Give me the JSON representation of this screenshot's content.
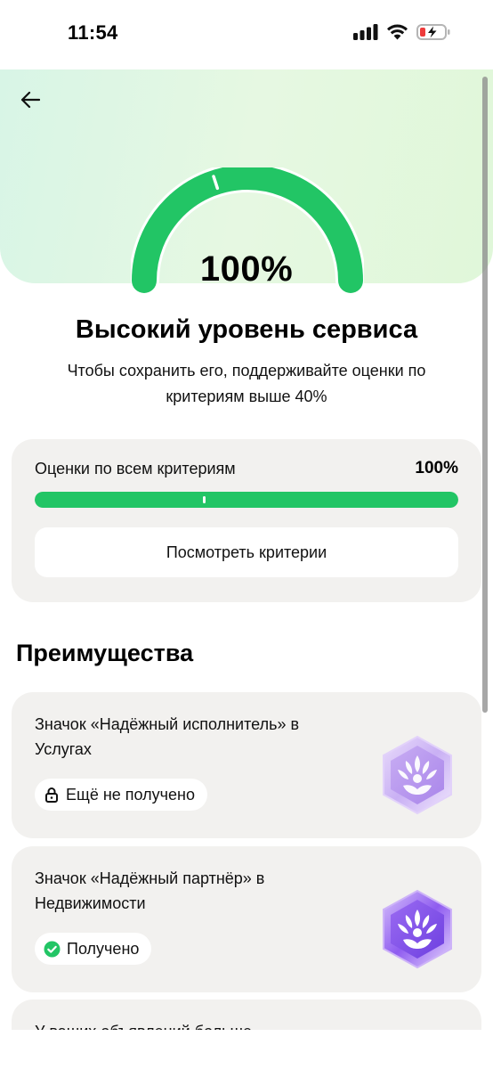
{
  "status_bar": {
    "time": "11:54",
    "icons": [
      "signal-icon",
      "wifi-icon",
      "battery-low-charging-icon"
    ]
  },
  "header": {
    "back_icon": "arrow-left-icon"
  },
  "gauge": {
    "percent_text": "100%",
    "level": 1.0,
    "threshold": 0.4,
    "color": "#22c565"
  },
  "service": {
    "title": "Высокий уровень сервиса",
    "description": "Чтобы сохранить его, поддерживайте оценки по критериям выше 40%"
  },
  "criteria": {
    "label": "Оценки по всем критериям",
    "value_text": "100%",
    "progress": 1.0,
    "threshold": 0.4,
    "button_label": "Посмотреть критерии"
  },
  "benefits": {
    "title": "Преимущества",
    "items": [
      {
        "text": "Значок «Надёжный исполнитель» в Услугах",
        "status": "Ещё не получено",
        "status_icon": "lock-icon",
        "medal_icon": "lotus-medal-icon-inactive"
      },
      {
        "text": "Значок «Надёжный партнёр» в Недвижимости",
        "status": "Получено",
        "status_icon": "check-circle-icon",
        "medal_icon": "lotus-medal-icon-active"
      },
      {
        "text": "У ваших объявлений больше"
      }
    ]
  },
  "colors": {
    "accent_green": "#22c565",
    "card_bg": "#f2f1ef",
    "medal_purple": "#8b5cf6"
  }
}
